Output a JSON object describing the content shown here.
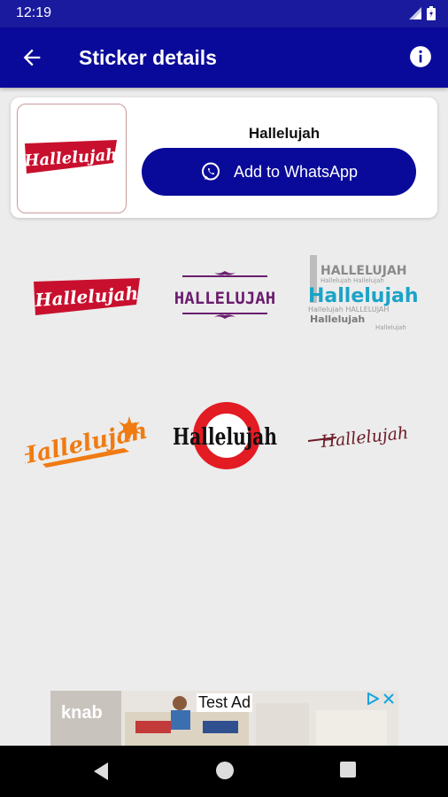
{
  "status_bar": {
    "time": "12:19"
  },
  "app_bar": {
    "title": "Sticker details"
  },
  "pack": {
    "name": "Hallelujah",
    "add_button_label": "Add to WhatsApp"
  },
  "stickers": [
    {
      "text": "Hallelujah",
      "style": "red-banner"
    },
    {
      "text": "HALLELUJAH",
      "style": "purple-frame"
    },
    {
      "text": "Hallelujah",
      "style": "blue-word-cloud"
    },
    {
      "text": "Hallelujah",
      "style": "orange-brush"
    },
    {
      "text": "Hallelujah",
      "style": "black-red-ring"
    },
    {
      "text": "Hallelujah",
      "style": "maroon-script"
    }
  ],
  "word_cloud": {
    "top": "HALLELUJAH",
    "small_1": "Hallelujah Hallelujah",
    "small_2": "Hallelujah HALLELUJAH",
    "small_3": "Hallelujah",
    "small_4": "Hallelujah"
  },
  "ad": {
    "label": "Test Ad",
    "brand": "knab"
  },
  "colors": {
    "status": "#1a1a9e",
    "appbar": "#0a0a9a",
    "button": "#0a0a9a",
    "background": "#ececec"
  }
}
